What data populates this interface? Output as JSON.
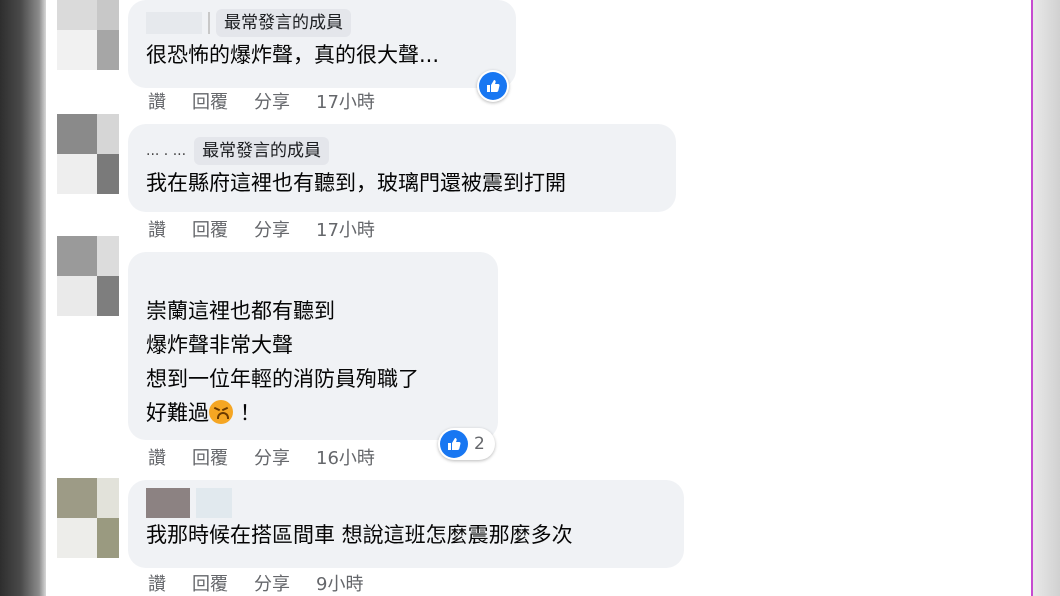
{
  "comments": [
    {
      "badge": "最常發言的成員",
      "lines": [
        "很恐怖的爆炸聲，真的很大聲..."
      ],
      "actions": {
        "like": "讚",
        "reply": "回覆",
        "share": "分享",
        "time": "17小時"
      },
      "reaction": {
        "icon": "thumbs-up-icon",
        "count": ""
      }
    },
    {
      "name_dots": "... . ...",
      "badge": "最常發言的成員",
      "lines": [
        "我在縣府這裡也有聽到，玻璃門還被震到打開"
      ],
      "actions": {
        "like": "讚",
        "reply": "回覆",
        "share": "分享",
        "time": "17小時"
      }
    },
    {
      "lines": [
        "崇蘭這裡也都有聽到",
        "爆炸聲非常大聲",
        "想到一位年輕的消防員殉職了",
        "好難過"
      ],
      "last_line_suffix": "！",
      "actions": {
        "like": "讚",
        "reply": "回覆",
        "share": "分享",
        "time": "16小時"
      },
      "reaction": {
        "icon": "thumbs-up-icon",
        "count": "2"
      }
    },
    {
      "lines": [
        "我那時候在搭區間車 想說這班怎麼震那麼多次"
      ],
      "actions": {
        "like": "讚",
        "reply": "回覆",
        "share": "分享",
        "time": "9小時"
      }
    }
  ],
  "colors": {
    "bubble": "#f0f2f5",
    "badge": "#e4e6eb",
    "like_blue": "#1877f2",
    "meta_gray": "#65676b",
    "text": "#050505",
    "right_border": "#c64bd0"
  }
}
